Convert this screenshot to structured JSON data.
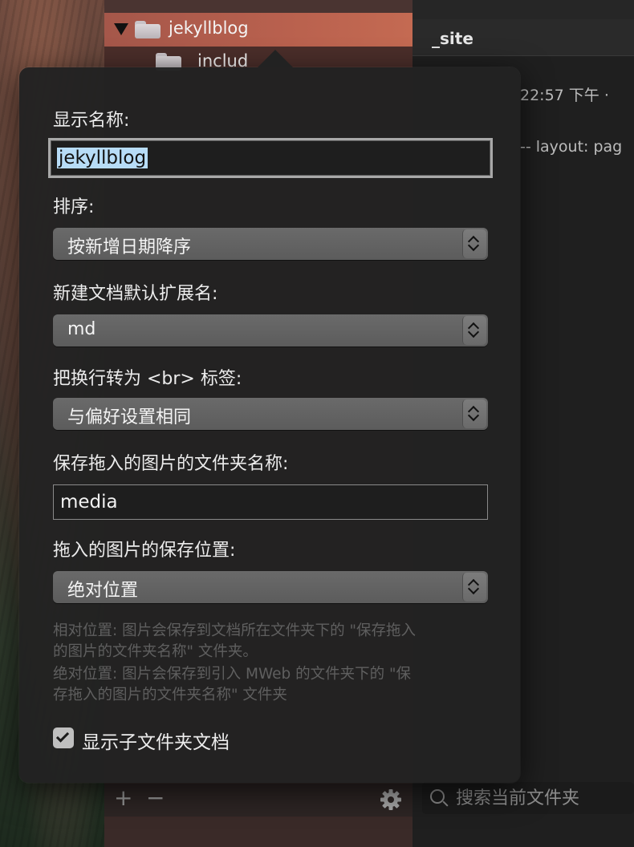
{
  "sidebar": {
    "selected_folder": "jekyllblog",
    "child_folder": "includ",
    "add_label": "+",
    "remove_label": "−"
  },
  "content": {
    "tab_title": "_site",
    "date_line": "22:57 下午 ·",
    "snippet_line": "-- layout: pag",
    "search_placeholder": "搜索当前文件夹"
  },
  "popover": {
    "display_name_label": "显示名称:",
    "display_name_value": "jekyllblog",
    "sort_label": "排序:",
    "sort_value": "按新增日期降序",
    "ext_label": "新建文档默认扩展名:",
    "ext_value": "md",
    "br_label": "把换行转为 <br> 标签:",
    "br_value": "与偏好设置相同",
    "img_folder_label": "保存拖入的图片的文件夹名称:",
    "img_folder_value": "media",
    "img_pos_label": "拖入的图片的保存位置:",
    "img_pos_value": "绝对位置",
    "help_lines": [
      "相对位置: 图片会保存到文档所在文件夹下的 \"保存拖入",
      "的图片的文件夹名称\" 文件夹。",
      "绝对位置: 图片会保存到引入 MWeb 的文件夹下的 \"保",
      "存拖入的图片的文件夹名称\" 文件夹"
    ],
    "show_subfolder_label": "显示子文件夹文档",
    "show_subfolder_checked": true
  }
}
